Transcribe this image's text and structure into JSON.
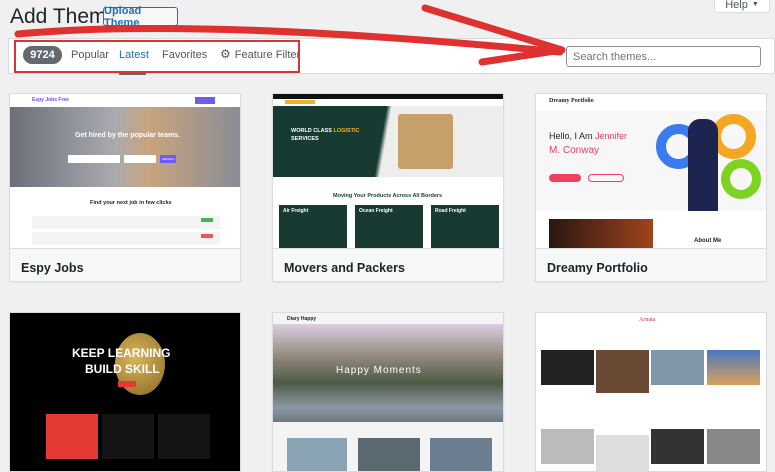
{
  "header": {
    "title": "Add Themes",
    "upload_label": "Upload Theme",
    "help_label": "Help",
    "help_arrow": "▼"
  },
  "filter": {
    "count": "9724",
    "tabs": [
      "Popular",
      "Latest",
      "Favorites"
    ],
    "active_tab": "Latest",
    "feature_filter": "Feature Filter",
    "search_placeholder": "Search themes..."
  },
  "annotation_color": "#e03131",
  "themes": [
    {
      "name": "Espy Jobs",
      "preview": {
        "logo": "Espy Jobs Free",
        "headline": "Get hired by the popular teams.",
        "button": "SEARCH",
        "section": "Find your next job in few clicks"
      }
    },
    {
      "name": "Movers and Packers",
      "preview": {
        "headline_a": "WORLD CLASS ",
        "headline_b": "LOGISTIC",
        "headline_c": "SERVICES",
        "section": "Moving Your Products Across All Borders",
        "boxes": [
          "Air Freight",
          "Ocean Freight",
          "Road Freight"
        ]
      }
    },
    {
      "name": "Dreamy Portfolio",
      "preview": {
        "logo": "Dreamy Portfolio",
        "hello": "Hello, I Am ",
        "name_a": "Jennifer",
        "name_b": "M. Conway",
        "about": "About Me"
      }
    },
    {
      "name": "",
      "preview": {
        "headline_a": "KEEP LEARNING",
        "headline_b": "BUILD SKILL"
      }
    },
    {
      "name": "",
      "preview": {
        "logo": "Diary Happy",
        "headline": "Happy Moments"
      }
    },
    {
      "name": "",
      "preview": {
        "logo": "Arnata"
      }
    }
  ]
}
